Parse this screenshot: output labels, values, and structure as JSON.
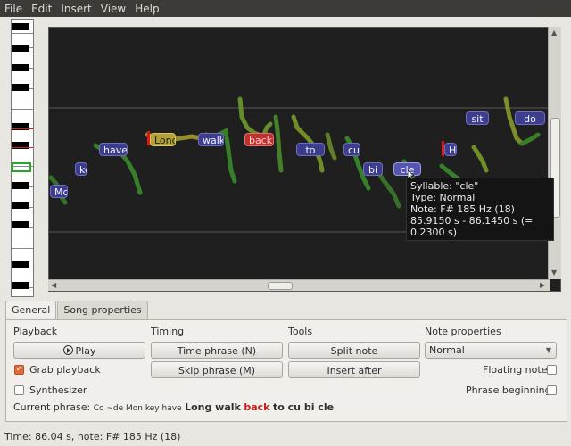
{
  "menu": [
    "File",
    "Edit",
    "Insert",
    "View",
    "Help"
  ],
  "syllables": [
    {
      "text": "Mon",
      "style": "normal"
    },
    {
      "text": "ke",
      "style": "normal"
    },
    {
      "text": "have",
      "style": "normal"
    },
    {
      "text": "Long",
      "style": "gold"
    },
    {
      "text": "walk",
      "style": "normal"
    },
    {
      "text": "back",
      "style": "selected"
    },
    {
      "text": "to",
      "style": "normal"
    },
    {
      "text": "cu",
      "style": "normal"
    },
    {
      "text": "bi",
      "style": "normal"
    },
    {
      "text": "cle",
      "style": "lite"
    },
    {
      "text": "He",
      "style": "normal"
    },
    {
      "text": "sit",
      "style": "normal"
    },
    {
      "text": "do",
      "style": "normal"
    }
  ],
  "tooltip": {
    "line1": "Syllable: \"cle\"",
    "line2": "Type: Normal",
    "line3": "Note: F# 185 Hz (18)",
    "line4": "85.9150 s - 86.1450 s (= 0.2300 s)"
  },
  "tabs": {
    "general": "General",
    "song_properties": "Song properties"
  },
  "playback": {
    "heading": "Playback",
    "play_label": "Play",
    "grab_label": "Grab playback",
    "grab_checked": true,
    "synth_label": "Synthesizer",
    "synth_checked": false
  },
  "timing": {
    "heading": "Timing",
    "time_phrase_label": "Time phrase (N)",
    "skip_phrase_label": "Skip phrase (M)"
  },
  "tools": {
    "heading": "Tools",
    "split_note_label": "Split note",
    "insert_after_label": "Insert after"
  },
  "note_properties": {
    "heading": "Note properties",
    "type_value": "Normal",
    "floating_label": "Floating note",
    "floating_checked": false,
    "phrase_beginning_label": "Phrase beginning",
    "phrase_beginning_checked": false
  },
  "current_phrase": {
    "label": "Current phrase:",
    "small_words": "Co ~de Mon key have",
    "bold_words_1": "Long walk",
    "selected_word": "back",
    "bold_words_2": "to cu bi cle"
  },
  "status": "Time: 86.04 s, note: F# 185 Hz (18)",
  "colors": {
    "menubar": "#3c3b37",
    "canvas": "#1f1f1f",
    "syllable": "#3d3d8d",
    "selected": "#c13030",
    "current": "#b3a233",
    "pitch_green": "#3a8a2a",
    "pitch_yellow": "#b0a030",
    "checkbox_on": "#e16b3a"
  }
}
